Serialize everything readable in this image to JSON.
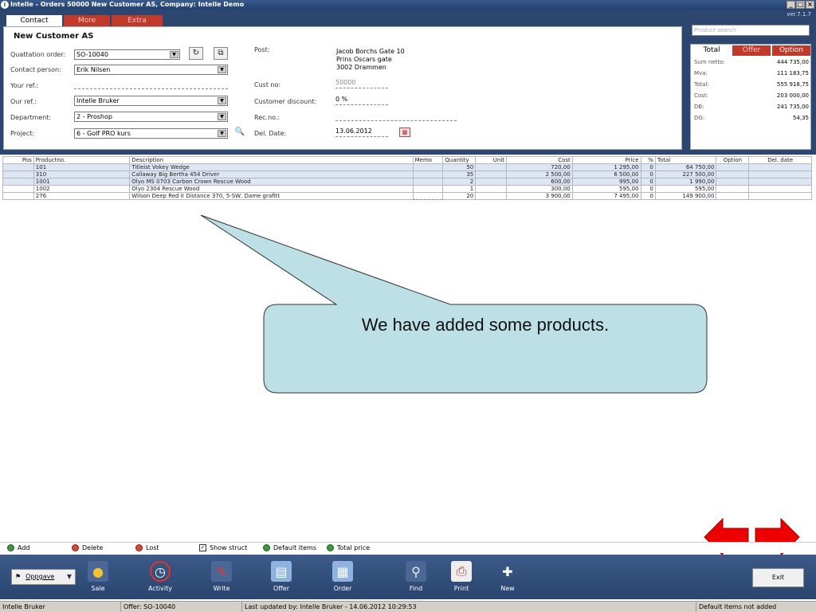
{
  "window": {
    "title": "Intelle - Orders  50000 New Customer AS,  Company: Intelle Demo",
    "version": "ver.7.1.7"
  },
  "tabs": [
    {
      "label": "Contact"
    },
    {
      "label": "More"
    },
    {
      "label": "Extra"
    }
  ],
  "form": {
    "customer_name": "New Customer AS",
    "quotation_order_label": "Quattation order:",
    "quotation_order_value": "SO-10040",
    "contact_person_label": "Contact person:",
    "contact_person_value": "Erik Nilsen",
    "your_ref_label": "Your ref.:",
    "our_ref_label": "Our ref.:",
    "our_ref_value": "Intelle Bruker",
    "department_label": "Department:",
    "department_value": "2 - Proshop",
    "project_label": "Project:",
    "project_value": "6 - Golf PRO kurs",
    "post_label": "Post:",
    "address": [
      "Jacob Borchs Gate 10",
      "Prins Oscars gate",
      "3002 Drammen"
    ],
    "cust_no_label": "Cust no:",
    "cust_no_value": "50000",
    "discount_label": "Customer discount:",
    "discount_value": "0 %",
    "rec_no_label": "Rec.no.:",
    "del_date_label": "Del. Date:",
    "del_date_value": "13.06.2012"
  },
  "product_search": {
    "placeholder": "Product search"
  },
  "totals": {
    "tabs": [
      "Total",
      "Offer",
      "Option"
    ],
    "rows": [
      {
        "label": "Sum netto:",
        "value": "444 735,00"
      },
      {
        "label": "Mva:",
        "value": "111 183,75"
      },
      {
        "label": "Total:",
        "value": "555 918,75"
      },
      {
        "label": "Cost:",
        "value": "203 000,00"
      },
      {
        "label": "DB:",
        "value": "241 735,00"
      },
      {
        "label": "DG:",
        "value": "54,35"
      }
    ]
  },
  "grid": {
    "columns": [
      "Pos",
      "Productno.",
      "Description",
      "Memo",
      "Quantity",
      "Unit",
      "Cost",
      "Price",
      "%",
      "Total",
      "Option",
      "Del. date"
    ],
    "rows": [
      {
        "productno": "101",
        "description": "Titleist Vokey Wedge",
        "quantity": "50",
        "cost": "720,00",
        "price": "1 295,00",
        "pct": "0",
        "total": "64 750,00"
      },
      {
        "productno": "310",
        "description": "Callaway Big Bertha 454 Driver",
        "quantity": "35",
        "cost": "2 500,00",
        "price": "6 500,00",
        "pct": "0",
        "total": "227 500,00"
      },
      {
        "productno": "1001",
        "description": "Olyo MS 0703 Carbon Crown Rescue Wood",
        "quantity": "2",
        "cost": "600,00",
        "price": "995,00",
        "pct": "0",
        "total": "1 990,00"
      },
      {
        "productno": "1002",
        "description": "Olyo 2304 Rescue Wood",
        "quantity": "1",
        "cost": "300,00",
        "price": "595,00",
        "pct": "0",
        "total": "595,00"
      },
      {
        "productno": "276",
        "description": "Wilson Deep Red II Distance 370, 5-SW, Dame grafitt",
        "quantity": "20",
        "cost": "3 900,00",
        "price": "7 495,00",
        "pct": "0",
        "total": "149 900,00"
      }
    ]
  },
  "callout": {
    "text": "We have added some products."
  },
  "actions": {
    "add": "Add",
    "delete": "Delete",
    "lost": "Lost",
    "show_struct": "Show struct",
    "default_items": "Default items",
    "total_price": "Total price"
  },
  "toolbar": {
    "oppgave": "Oppgave",
    "tools": [
      {
        "label": "Sale",
        "icon": "coins-icon"
      },
      {
        "label": "Activity",
        "icon": "clock-icon"
      },
      {
        "label": "Write",
        "icon": "pen-icon"
      },
      {
        "label": "Offer",
        "icon": "document-icon"
      },
      {
        "label": "Order",
        "icon": "order-icon"
      },
      {
        "label": "Find",
        "icon": "magnifier-icon"
      },
      {
        "label": "Print",
        "icon": "printer-icon"
      },
      {
        "label": "New",
        "icon": "new-icon"
      }
    ],
    "exit": "Exit"
  },
  "statusbar": {
    "user": "Intelle Bruker",
    "offer": "Offer: SO-10040",
    "updated": "Last updated by: Intelle Bruker - 14.06.2012 10:29:53",
    "default_items": "Default items not added"
  }
}
